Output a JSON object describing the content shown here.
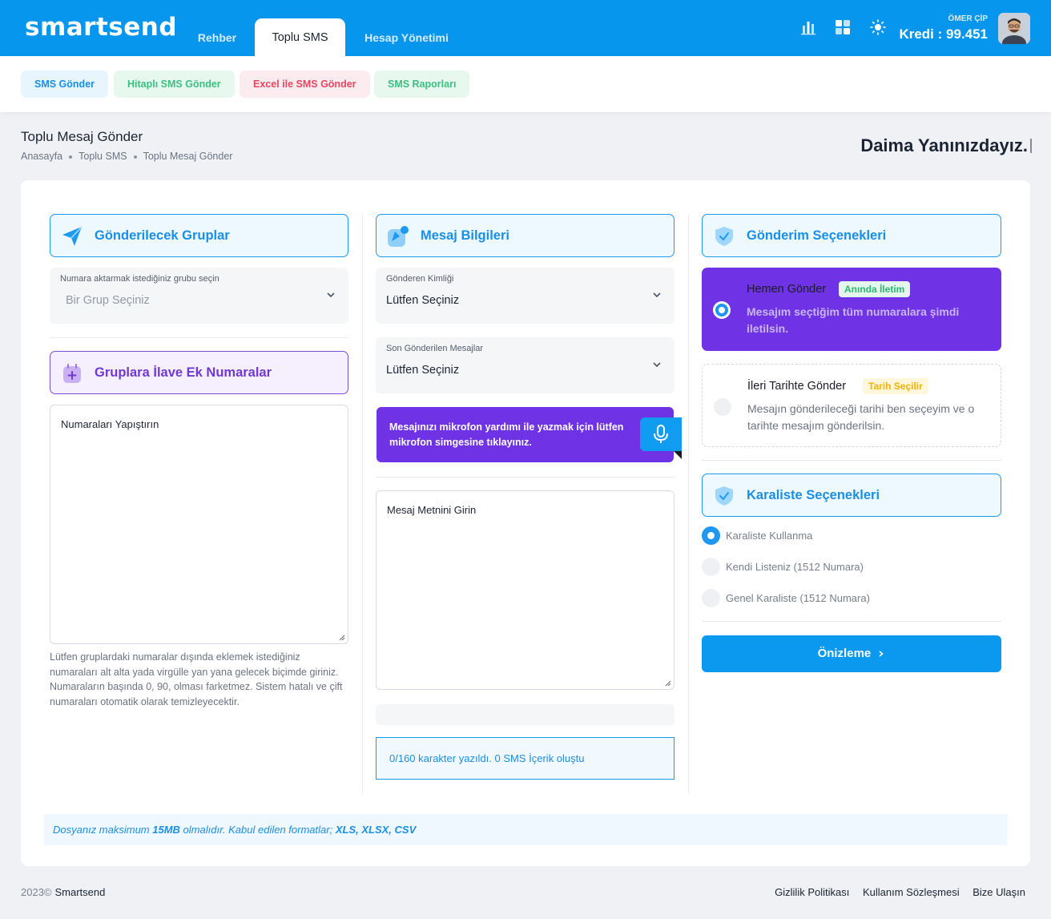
{
  "header": {
    "logo": "smartsend",
    "tabs": [
      "Rehber",
      "Toplu SMS",
      "Hesap Yönetimi"
    ],
    "user_name": "ÖMER ÇİP",
    "credit": "Kredi : 99.451",
    "icons": [
      "bar-chart-icon",
      "apps-grid-icon",
      "sun-icon"
    ]
  },
  "subnav": {
    "buttons": [
      "SMS Gönder",
      "Hitaplı SMS Gönder",
      "Excel ile SMS Gönder",
      "SMS Raporları"
    ]
  },
  "page": {
    "title": "Toplu Mesaj Gönder",
    "breadcrumb": [
      "Anasayfa",
      "Toplu SMS",
      "Toplu Mesaj Gönder"
    ],
    "tagline": "Daima Yanınızdayız."
  },
  "groups": {
    "heading": "Gönderilecek Gruplar",
    "select_label": "Numara aktarmak istediğiniz grubu seçin",
    "select_placeholder": "Bir Grup Seçiniz",
    "extra_heading": "Gruplara İlave Ek Numaralar",
    "textarea_placeholder": "Numaraları Yapıştırın",
    "hint": "Lütfen gruplardaki numaralar dışında eklemek istediğiniz numaraları alt alta yada virgülle yan yana gelecek biçimde giriniz. Numaraların başında 0, 90, olması farketmez. Sistem hatalı ve çift numaraları otomatik olarak temizleyecektir."
  },
  "message": {
    "heading": "Mesaj Bilgileri",
    "sender_label": "Gönderen Kimliği",
    "sender_value": "Lütfen Seçiniz",
    "recent_label": "Son Gönderilen Mesajlar",
    "recent_value": "Lütfen Seçiniz",
    "mic_text": "Mesajınızı mikrofon yardımı ile yazmak için lütfen mikrofon simgesine tıklayınız.",
    "textarea_placeholder": "Mesaj Metnini Girin",
    "counter": "0/160 karakter yazıldı. 0 SMS İçerik oluştu"
  },
  "send_options": {
    "heading": "Gönderim Seçenekleri",
    "now_title": "Hemen Gönder",
    "now_badge": "Anında İletim",
    "now_desc": "Mesajım seçtiğim tüm numaralara şimdi iletilsin.",
    "later_title": "İleri Tarihte Gönder",
    "later_badge": "Tarih Seçilir",
    "later_desc": "Mesajın gönderileceği tarihi ben seçeyim ve o tarihte mesajım gönderilsin.",
    "selected": "now"
  },
  "blacklist": {
    "heading": "Karaliste Seçenekleri",
    "options": [
      "Karaliste Kullanma",
      "Kendi Listeniz (1512 Numara)",
      "Genel Karaliste (1512 Numara)"
    ],
    "selected_index": 0
  },
  "preview_button": "Önizleme",
  "file_info": {
    "prefix": "Dosyanız maksimum ",
    "size": "15MB",
    "middle": " olmalıdır. Kabul edilen formatlar; ",
    "formats": "XLS, XLSX, CSV"
  },
  "footer": {
    "year": "2023©",
    "brand": "Smartsend",
    "links": [
      "Gizlilik Politikası",
      "Kullanım Sözleşmesi",
      "Bize Ulaşın"
    ]
  },
  "colors": {
    "primary": "#0696ee",
    "purple": "#6f32e5",
    "badge_green": "#2bb673",
    "badge_yellow": "#f5b301"
  }
}
